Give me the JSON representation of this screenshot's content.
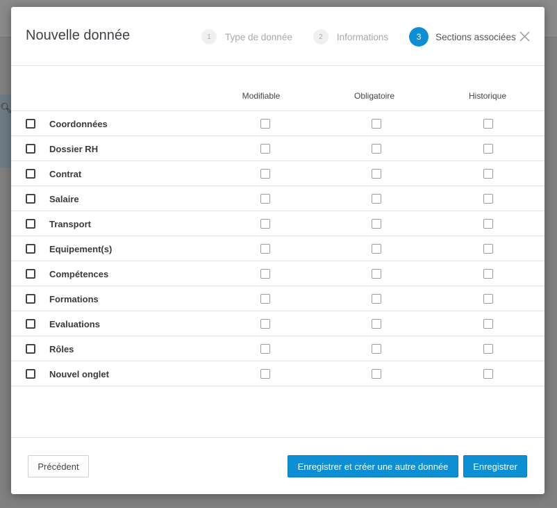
{
  "modal": {
    "title": "Nouvelle donnée",
    "steps": [
      {
        "num": "1",
        "label": "Type de donnée",
        "active": false
      },
      {
        "num": "2",
        "label": "Informations",
        "active": false
      },
      {
        "num": "3",
        "label": "Sections associées",
        "active": true
      }
    ],
    "close_icon": "close-icon"
  },
  "table": {
    "columns": [
      "Modifiable",
      "Obligatoire",
      "Historique"
    ],
    "rows": [
      {
        "label": "Coordonnées",
        "checked": false,
        "modifiable": false,
        "obligatoire": false,
        "historique": false
      },
      {
        "label": "Dossier RH",
        "checked": false,
        "modifiable": false,
        "obligatoire": false,
        "historique": false
      },
      {
        "label": "Contrat",
        "checked": false,
        "modifiable": false,
        "obligatoire": false,
        "historique": false
      },
      {
        "label": "Salaire",
        "checked": false,
        "modifiable": false,
        "obligatoire": false,
        "historique": false
      },
      {
        "label": "Transport",
        "checked": false,
        "modifiable": false,
        "obligatoire": false,
        "historique": false
      },
      {
        "label": "Equipement(s)",
        "checked": false,
        "modifiable": false,
        "obligatoire": false,
        "historique": false
      },
      {
        "label": "Compétences",
        "checked": false,
        "modifiable": false,
        "obligatoire": false,
        "historique": false
      },
      {
        "label": "Formations",
        "checked": false,
        "modifiable": false,
        "obligatoire": false,
        "historique": false
      },
      {
        "label": "Evaluations",
        "checked": false,
        "modifiable": false,
        "obligatoire": false,
        "historique": false
      },
      {
        "label": "Rôles",
        "checked": false,
        "modifiable": false,
        "obligatoire": false,
        "historique": false
      },
      {
        "label": "Nouvel onglet",
        "checked": false,
        "modifiable": false,
        "obligatoire": false,
        "historique": false
      }
    ]
  },
  "footer": {
    "previous_label": "Précédent",
    "save_and_new_label": "Enregistrer et créer une autre donnée",
    "save_label": "Enregistrer"
  },
  "colors": {
    "accent": "#0e8ed3",
    "text": "#333333",
    "border": "#e2e2e2"
  }
}
